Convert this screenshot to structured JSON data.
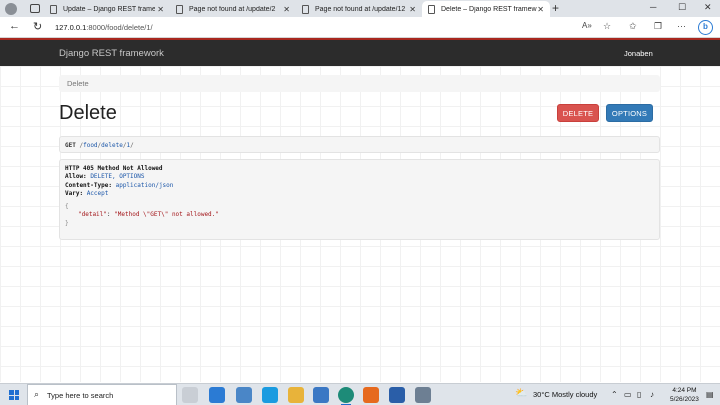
{
  "browser": {
    "tabs": [
      {
        "title": "Update – Django REST framewor",
        "active": false
      },
      {
        "title": "Page not found at /update/2",
        "active": false
      },
      {
        "title": "Page not found at /update/12",
        "active": false
      },
      {
        "title": "Delete – Django REST framework",
        "active": true
      }
    ],
    "url_host": "127.0.0.1",
    "url_rest": ":8000/food/delete/1/",
    "bing_label": "b"
  },
  "navbar": {
    "brand": "Django REST framework",
    "user": "Jonaben"
  },
  "breadcrumb": "Delete",
  "page_title": "Delete",
  "buttons": {
    "delete": "DELETE",
    "options": "OPTIONS"
  },
  "request": {
    "method": "GET",
    "path_sep1": "/",
    "path_p1": "food",
    "path_sep2": "/",
    "path_p2": "delete",
    "path_sep3": "/",
    "path_p3": "1",
    "path_sep4": "/"
  },
  "response": {
    "status": "HTTP 405 Method Not Allowed",
    "headers": [
      {
        "name": "Allow:",
        "value": "DELETE, OPTIONS"
      },
      {
        "name": "Content-Type:",
        "value": "application/json"
      },
      {
        "name": "Vary:",
        "value": "Accept"
      }
    ],
    "open_brace": "{",
    "body_key": "\"detail\"",
    "body_colon": ": ",
    "body_value": "\"Method \\\"GET\\\" not allowed.\"",
    "close_brace": "}"
  },
  "taskbar": {
    "search_placeholder": "Type here to search",
    "weather": "30°C  Mostly cloudy",
    "time": "4:24 PM",
    "date": "5/26/2023"
  },
  "colors": {
    "navbar_bg": "#2c2c2c",
    "navbar_accent": "#a8281f",
    "delete_btn": "#d9534f",
    "options_btn": "#337ab7"
  }
}
